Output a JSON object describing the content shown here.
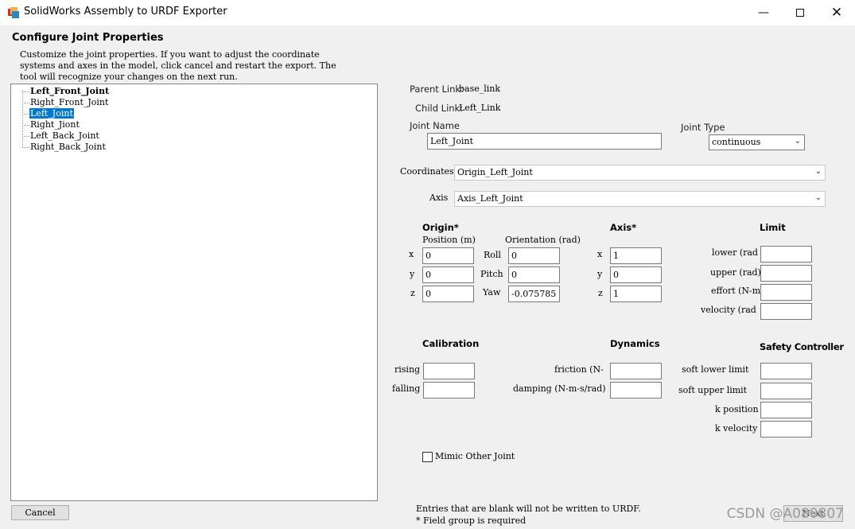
{
  "window": {
    "title": "SolidWorks Assembly to URDF Exporter",
    "minimize_icon": "minimize-icon",
    "maximize_icon": "maximize-icon",
    "close_icon": "close-icon"
  },
  "page": {
    "heading": "Configure Joint Properties",
    "description_1": "Customize the joint properties. If you want to adjust the coordinate",
    "description_2": "systems and axes in the model, click cancel and restart the export. The",
    "description_3": "tool will recognize your changes on the next run."
  },
  "tree": {
    "items": [
      "Left_Front_Joint",
      "Right_Front_Joint",
      "Left_Joint",
      "Right_Jiont",
      "Left_Back_Joint",
      "Right_Back_Joint"
    ],
    "selected": "Left_Joint",
    "bold": "Left_Front_Joint"
  },
  "joint": {
    "parent_label": "Parent Link:",
    "parent_value": "base_link",
    "child_label": "Child Link:",
    "child_value": "Left_Link",
    "name_label": "Joint Name",
    "name_value": "Left_Joint",
    "type_label": "Joint Type",
    "type_value": "continuous",
    "coordinates_label": "Coordinates",
    "coordinates_value": "Origin_Left_Joint",
    "axis_label": "Axis",
    "axis_value": "Axis_Left_Joint"
  },
  "origin": {
    "header": "Origin*",
    "position_label": "Position (m)",
    "orientation_label": "Orientation (rad)",
    "x_label": "x",
    "x": "0",
    "y_label": "y",
    "y": "0",
    "z_label": "z",
    "z": "0",
    "roll_label": "Roll",
    "roll": "0",
    "pitch_label": "Pitch",
    "pitch": "0",
    "yaw_label": "Yaw",
    "yaw": "-0.075785"
  },
  "axis": {
    "header": "Axis*",
    "x_label": "x",
    "x": "1",
    "y_label": "y",
    "y": "0",
    "z_label": "z",
    "z": "1"
  },
  "limit": {
    "header": "Limit",
    "lower_label": "lower (rad",
    "upper_label": "upper (rad)",
    "effort_label": "effort (N-m",
    "velocity_label": "velocity (rad"
  },
  "calibration": {
    "header": "Calibration",
    "rising_label": "rising",
    "falling_label": "falling"
  },
  "dynamics": {
    "header": "Dynamics",
    "friction_label": "friction (N-",
    "damping_label": "damping (N-m-s/rad)"
  },
  "safety": {
    "header": "Safety Controller",
    "soft_lower_label": "soft lower limit",
    "soft_upper_label": "soft upper limit",
    "k_position_label": "k position",
    "k_velocity_label": "k velocity"
  },
  "mimic": {
    "label": "Mimic Other Joint"
  },
  "footer": {
    "cancel": "Cancel",
    "next": "Next",
    "note_1": "Entries that are blank will not be written to URDF.",
    "note_2": "* Field group is required"
  },
  "watermark": "CSDN @A080807"
}
